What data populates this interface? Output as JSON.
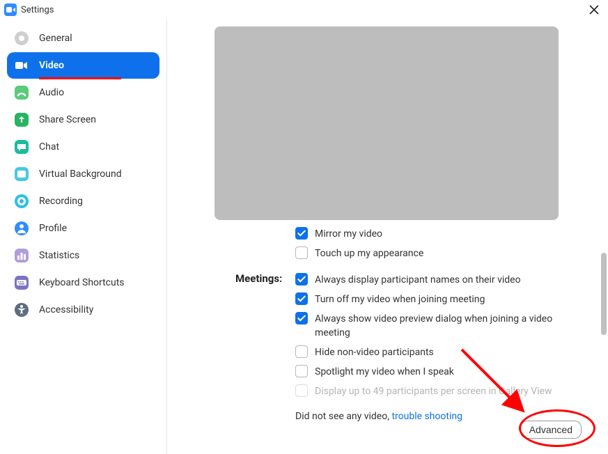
{
  "window": {
    "title": "Settings"
  },
  "sidebar": {
    "items": [
      {
        "label": "General"
      },
      {
        "label": "Video"
      },
      {
        "label": "Audio"
      },
      {
        "label": "Share Screen"
      },
      {
        "label": "Chat"
      },
      {
        "label": "Virtual Background"
      },
      {
        "label": "Recording"
      },
      {
        "label": "Profile"
      },
      {
        "label": "Statistics"
      },
      {
        "label": "Keyboard Shortcuts"
      },
      {
        "label": "Accessibility"
      }
    ],
    "active_index": 1
  },
  "video": {
    "partial_options": [
      {
        "label": "Mirror my video",
        "checked": true
      },
      {
        "label": "Touch up my appearance",
        "checked": false
      }
    ],
    "meetings_label": "Meetings:",
    "meeting_options": [
      {
        "label": "Always display participant names on their video",
        "checked": true,
        "disabled": false
      },
      {
        "label": "Turn off my video when joining meeting",
        "checked": true,
        "disabled": false
      },
      {
        "label": "Always show video preview dialog when joining a video meeting",
        "checked": true,
        "disabled": false
      },
      {
        "label": "Hide non-video participants",
        "checked": false,
        "disabled": false
      },
      {
        "label": "Spotlight my video when I speak",
        "checked": false,
        "disabled": false
      },
      {
        "label": "Display up to 49 participants per screen in Gallery View",
        "checked": false,
        "disabled": true
      }
    ],
    "help_prefix": "Did not see any video,  ",
    "help_link": "trouble shooting",
    "advanced_label": "Advanced"
  }
}
